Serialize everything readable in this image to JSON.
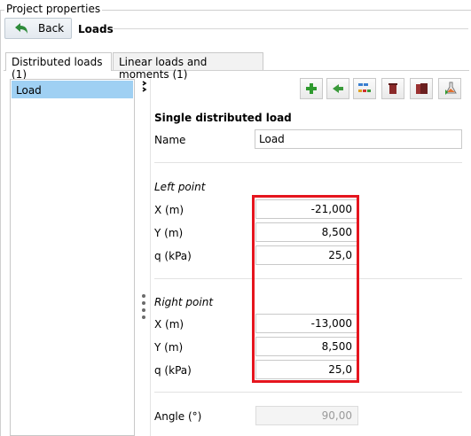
{
  "group_title": "Project properties",
  "header": {
    "back_label": "Back",
    "page_title": "Loads"
  },
  "tabs": [
    {
      "label": "Distributed loads (1)",
      "active": true
    },
    {
      "label": "Linear loads and moments (1)",
      "active": false
    }
  ],
  "list": {
    "items": [
      {
        "label": "Load",
        "selected": true
      }
    ]
  },
  "toolbar": {
    "icons": [
      "add-icon",
      "copy-icon",
      "table-icon",
      "delete-icon",
      "delete-all-icon",
      "apply-icon"
    ]
  },
  "form": {
    "section_title": "Single distributed load",
    "name_label": "Name",
    "name_value": "Load",
    "left_point": {
      "title": "Left point",
      "x_label": "X (m)",
      "x_value": "-21,000",
      "y_label": "Y (m)",
      "y_value": "8,500",
      "q_label": "q (kPa)",
      "q_value": "25,0"
    },
    "right_point": {
      "title": "Right point",
      "x_label": "X (m)",
      "x_value": "-13,000",
      "y_label": "Y (m)",
      "y_value": "8,500",
      "q_label": "q (kPa)",
      "q_value": "25,0"
    },
    "angle_label": "Angle (°)",
    "angle_value": "90,00"
  },
  "colors": {
    "highlight_box": "#e5151e",
    "selection": "#9fd0f3"
  }
}
